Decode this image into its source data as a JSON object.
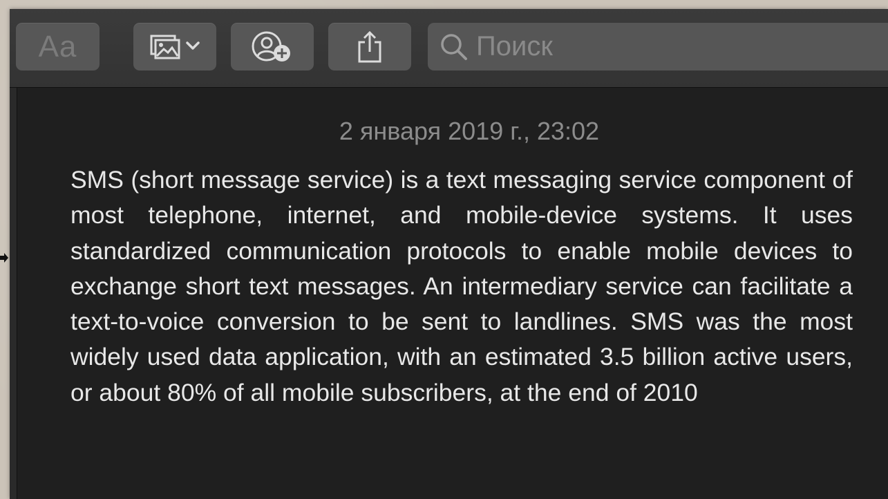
{
  "toolbar": {
    "format_label": "Aa",
    "media_icon": "photo-media-icon",
    "collab_icon": "add-person-icon",
    "share_icon": "share-icon",
    "search_placeholder": "Поиск"
  },
  "note": {
    "date": "2 января 2019 г., 23:02",
    "body": "SMS (short message service) is a text messaging service component of most telephone, internet, and mobile-device systems. It uses standardized communication protocols to enable mobile devices to exchange short text messages. An intermediary service can facilitate a text-to-voice conversion to be sent to landlines. SMS was the most widely used data application, with an estimated 3.5 billion active users, or about 80% of all mobile subscribers, at the end of 2010"
  }
}
